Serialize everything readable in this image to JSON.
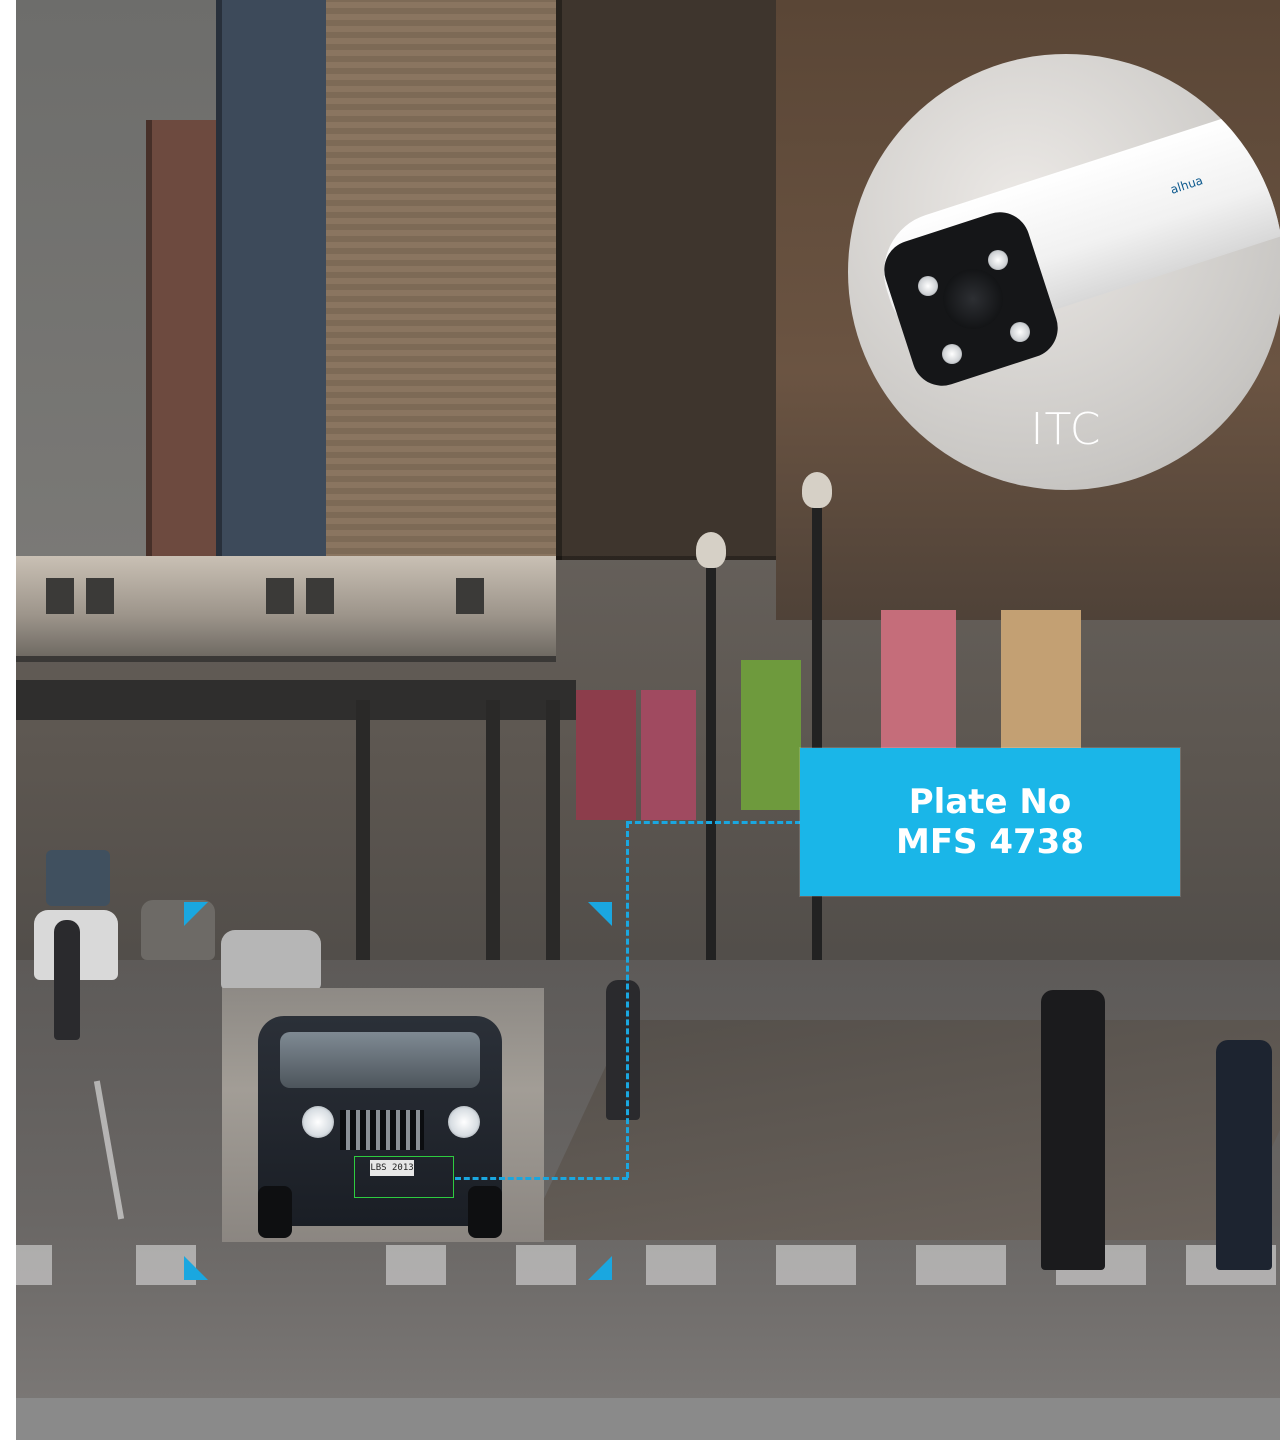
{
  "scene": {
    "camera": {
      "label": "ITC",
      "brand": "alhua"
    },
    "plate_card": {
      "line1": "Plate No",
      "line2": "MFS 4738"
    },
    "snapshot": {
      "plate_text": "LBS 2013"
    },
    "colors": {
      "accent": "#1ab6e8",
      "frame": "#1aa7e0",
      "detection_box": "#2ecc40",
      "bottom_bar": "#8a8a8a"
    },
    "icons": [
      "camera-icon"
    ]
  }
}
